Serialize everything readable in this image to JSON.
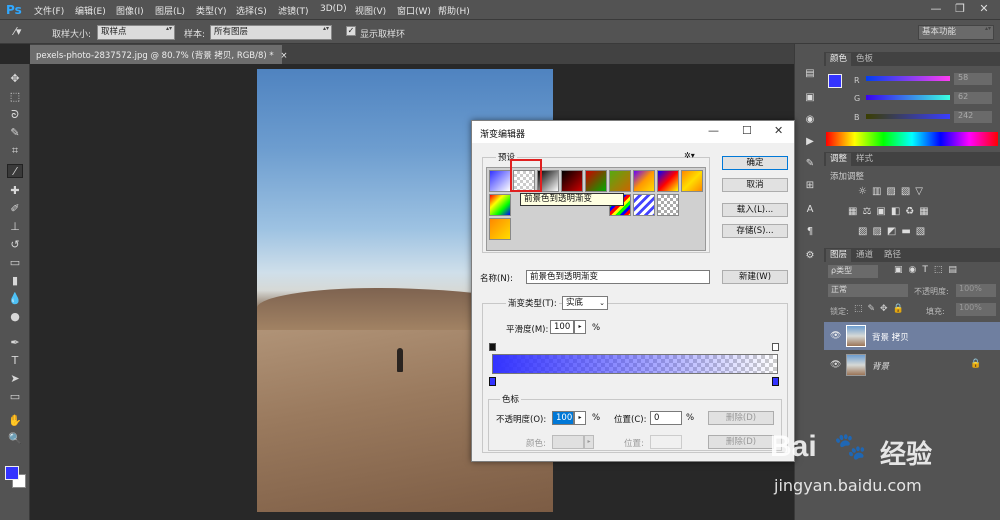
{
  "menubar": {
    "logo": "Ps",
    "items": [
      "文件(F)",
      "编辑(E)",
      "图像(I)",
      "图层(L)",
      "类型(Y)",
      "选择(S)",
      "滤镜(T)",
      "3D(D)",
      "视图(V)",
      "窗口(W)",
      "帮助(H)"
    ],
    "minimize": "—",
    "restore": "❐",
    "close": "✕"
  },
  "options": {
    "sample_size_label": "取样大小:",
    "sample_size_value": "取样点",
    "sample_label": "样本:",
    "sample_value": "所有图层",
    "show_ring_label": "显示取样环",
    "workspace": "基本功能"
  },
  "document": {
    "tab_title": "pexels-photo-2837572.jpg @ 80.7% (背景 拷贝, RGB/8) *",
    "tab_close": "×"
  },
  "tools": [
    "move-tool",
    "marquee-tool",
    "lasso-tool",
    "quick-select-tool",
    "crop-tool",
    "eyedropper-tool",
    "healing-tool",
    "brush-tool",
    "stamp-tool",
    "history-brush-tool",
    "eraser-tool",
    "gradient-tool",
    "blur-tool",
    "dodge-tool",
    "pen-tool",
    "type-tool",
    "path-select-tool",
    "rectangle-tool",
    "hand-tool",
    "zoom-tool"
  ],
  "tool_glyphs": [
    "✥",
    "⬚",
    "ᘐ",
    "✎",
    "⌗",
    "⁄",
    "✚",
    "✐",
    "⊥",
    "↺",
    "▭",
    "▮",
    "💧",
    "●",
    "✒",
    "T",
    "➤",
    "▭",
    "✋",
    "🔍"
  ],
  "colors": {
    "foreground": "#3333ff",
    "background": "#ffffff",
    "accent": "#0078d7",
    "highlight": "#e02020"
  },
  "color_panel": {
    "tabs": [
      "颜色",
      "色板"
    ],
    "r_label": "R",
    "g_label": "G",
    "b_label": "B",
    "r_value": "58",
    "g_value": "62",
    "b_value": "242"
  },
  "adjust_panel": {
    "tabs": [
      "调整",
      "样式"
    ],
    "add_label": "添加调整"
  },
  "layers_panel": {
    "tabs": [
      "图层",
      "通道",
      "路径"
    ],
    "kind": "ρ类型",
    "blend_mode": "正常",
    "opacity_label": "不透明度:",
    "opacity_value": "100%",
    "lock_label": "锁定:",
    "fill_label": "填充:",
    "fill_value": "100%",
    "layers": [
      {
        "name": "背景 拷贝"
      },
      {
        "name": "背景"
      }
    ]
  },
  "dialog": {
    "title": "渐变编辑器",
    "presets_label": "预设",
    "gear": "✲▾",
    "ok": "确定",
    "cancel": "取消",
    "load": "载入(L)...",
    "save": "存储(S)...",
    "tooltip": "前景色到透明渐变",
    "name_label": "名称(N):",
    "name_value": "前景色到透明渐变",
    "new_button": "新建(W)",
    "type_label": "渐变类型(T):",
    "type_value": "实底",
    "smooth_label": "平滑度(M):",
    "smooth_value": "100",
    "percent": "%",
    "stops_label": "色标",
    "opacity_label": "不透明度(O):",
    "opacity_value": "100",
    "location_label": "位置(C):",
    "location_value": "0",
    "delete_label": "删除(D)",
    "color_label": "颜色:",
    "location2_label": "位置:",
    "delete2_label": "删除(D)"
  },
  "watermark": {
    "brand": "Bai",
    "brand2": "经验",
    "url": "jingyan.baidu.com"
  }
}
